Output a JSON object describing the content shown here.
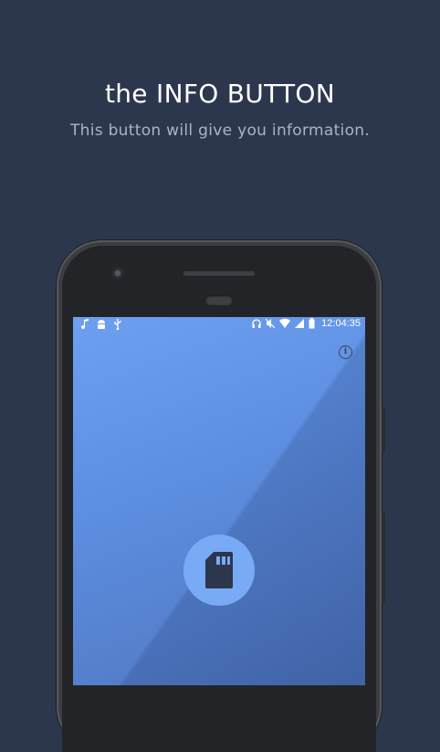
{
  "headline": "the INFO BUTTON",
  "subline": "This button will give you information.",
  "statusbar": {
    "time": "12:04:35",
    "left_icons": [
      "music-icon",
      "android-icon",
      "usb-icon"
    ],
    "right_icons": [
      "headphones-icon",
      "mute-icon",
      "wifi-icon",
      "signal-icon",
      "battery-icon"
    ]
  },
  "app": {
    "info_button_icon": "info-icon",
    "center_icon": "sd-card-icon",
    "info_glyph": "i"
  },
  "colors": {
    "background": "#2c374d",
    "screen_top": "#6ea0f1",
    "screen_bottom": "#4f76bf",
    "icon_circle": "#78aaf6",
    "icon_dark": "#2c374d"
  }
}
